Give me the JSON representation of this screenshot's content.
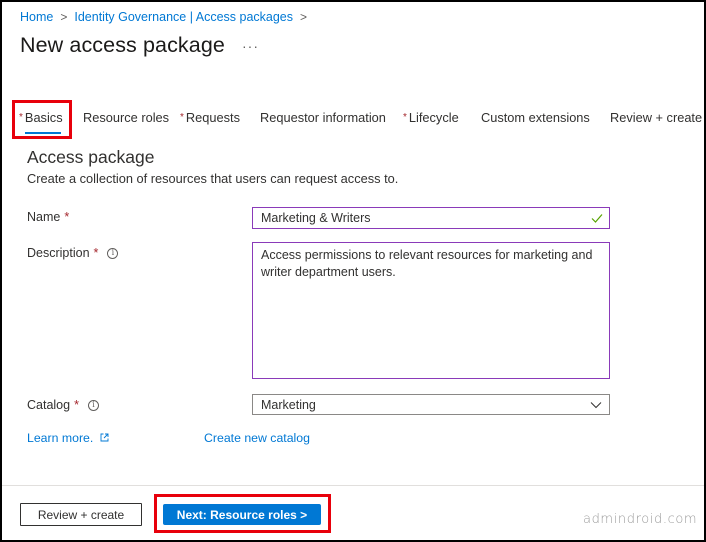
{
  "breadcrumb": {
    "items": [
      "Home",
      "Identity Governance | Access packages"
    ],
    "separator": ">"
  },
  "page": {
    "title": "New access package",
    "more_label": "···"
  },
  "tabs": [
    {
      "label": "Basics",
      "required": true,
      "active": true
    },
    {
      "label": "Resource roles",
      "required": false,
      "active": false
    },
    {
      "label": "Requests",
      "required": true,
      "active": false
    },
    {
      "label": "Requestor information",
      "required": false,
      "active": false
    },
    {
      "label": "Lifecycle",
      "required": true,
      "active": false
    },
    {
      "label": "Custom extensions",
      "required": false,
      "active": false
    },
    {
      "label": "Review + create",
      "required": false,
      "active": false
    }
  ],
  "required_marker": "*",
  "section": {
    "title": "Access package",
    "description": "Create a collection of resources that users can request access to."
  },
  "form": {
    "name": {
      "label": "Name",
      "value": "Marketing & Writers",
      "valid": true
    },
    "description": {
      "label": "Description",
      "value": "Access permissions to relevant resources for marketing and writer department users."
    },
    "catalog": {
      "label": "Catalog",
      "value": "Marketing"
    }
  },
  "info_glyph": "i",
  "links": {
    "learn_more": "Learn more.",
    "create_catalog": "Create new catalog"
  },
  "footer": {
    "review_create": "Review + create",
    "next": "Next: Resource roles >"
  },
  "watermark": "admindroid.com",
  "colors": {
    "accent": "#0078d4",
    "required": "#a4262c",
    "focus_border": "#8a3ab9",
    "valid_check": "#57a300",
    "highlight": "#e8000b"
  }
}
